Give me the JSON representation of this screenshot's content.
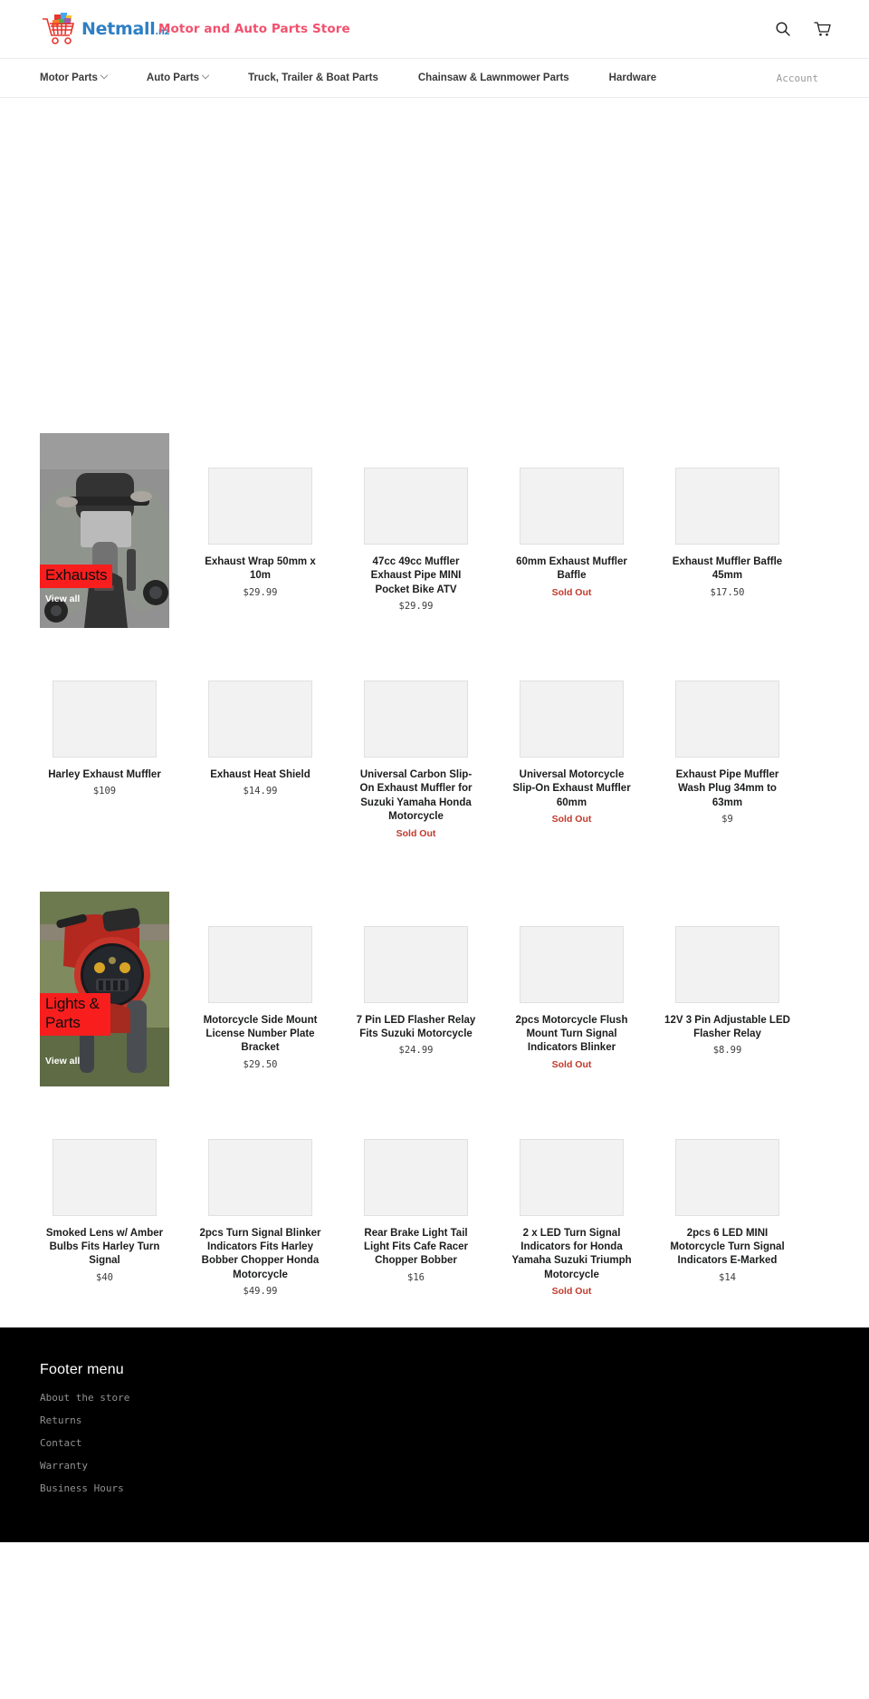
{
  "header": {
    "brand_name": "Netmall",
    "brand_tld": ".nz",
    "tagline": "Motor and Auto Parts Store",
    "brand_color": "#2f7fc4",
    "tagline_color": "#f2506e",
    "search_icon": "search-icon",
    "cart_icon": "cart-icon"
  },
  "nav": {
    "items": [
      {
        "label": "Motor Parts",
        "has_dropdown": true
      },
      {
        "label": "Auto Parts",
        "has_dropdown": true
      },
      {
        "label": "Truck, Trailer & Boat Parts",
        "has_dropdown": false
      },
      {
        "label": "Chainsaw & Lawnmower Parts",
        "has_dropdown": false
      },
      {
        "label": "Hardware",
        "has_dropdown": false
      }
    ],
    "account_label": "Account"
  },
  "collections": [
    {
      "title": "Exhausts",
      "view_all": "View all",
      "label_color": "#f91e1e",
      "image": "motorcycle-rear-exhaust-photo"
    },
    {
      "title": "Lights & Parts",
      "view_all": "View all",
      "label_color": "#f91e1e",
      "image": "motorcycle-headlight-photo"
    }
  ],
  "sold_out_label": "Sold Out",
  "sold_out_color": "#c0392b",
  "product_rows": [
    {
      "has_promo": true,
      "promo_index": 0,
      "products": [
        {
          "title": "Exhaust Wrap 50mm x 10m",
          "price": "$29.99",
          "sold_out": false
        },
        {
          "title": "47cc 49cc Muffler Exhaust Pipe MINI Pocket Bike ATV",
          "price": "$29.99",
          "sold_out": false
        },
        {
          "title": "60mm Exhaust Muffler Baffle",
          "price": "",
          "sold_out": true
        },
        {
          "title": "Exhaust Muffler Baffle 45mm",
          "price": "$17.50",
          "sold_out": false
        }
      ]
    },
    {
      "has_promo": false,
      "products": [
        {
          "title": "Harley Exhaust Muffler",
          "price": "$109",
          "sold_out": false
        },
        {
          "title": "Exhaust Heat Shield",
          "price": "$14.99",
          "sold_out": false
        },
        {
          "title": "Universal Carbon Slip-On Exhaust Muffler for Suzuki Yamaha Honda Motorcycle",
          "price": "",
          "sold_out": true
        },
        {
          "title": "Universal Motorcycle Slip-On Exhaust Muffler 60mm",
          "price": "",
          "sold_out": true
        },
        {
          "title": "Exhaust Pipe Muffler Wash Plug 34mm to 63mm",
          "price": "$9",
          "sold_out": false
        }
      ]
    },
    {
      "has_promo": true,
      "promo_index": 1,
      "products": [
        {
          "title": "Motorcycle Side Mount License Number Plate Bracket",
          "price": "$29.50",
          "sold_out": false
        },
        {
          "title": "7 Pin LED Flasher Relay Fits Suzuki Motorcycle",
          "price": "$24.99",
          "sold_out": false
        },
        {
          "title": "2pcs Motorcycle Flush Mount Turn Signal Indicators Blinker",
          "price": "",
          "sold_out": true
        },
        {
          "title": "12V 3 Pin Adjustable LED Flasher Relay",
          "price": "$8.99",
          "sold_out": false
        }
      ]
    },
    {
      "has_promo": false,
      "products": [
        {
          "title": "Smoked Lens w/ Amber Bulbs Fits Harley Turn Signal",
          "price": "$40",
          "sold_out": false
        },
        {
          "title": "2pcs Turn Signal Blinker Indicators Fits Harley Bobber Chopper Honda Motorcycle",
          "price": "$49.99",
          "sold_out": false
        },
        {
          "title": "Rear Brake Light Tail Light Fits Cafe Racer Chopper Bobber",
          "price": "$16",
          "sold_out": false
        },
        {
          "title": "2 x LED Turn Signal Indicators for Honda Yamaha Suzuki Triumph Motorcycle",
          "price": "",
          "sold_out": true
        },
        {
          "title": "2pcs 6 LED MINI Motorcycle Turn Signal Indicators E-Marked",
          "price": "$14",
          "sold_out": false
        }
      ]
    }
  ],
  "footer": {
    "title": "Footer menu",
    "links": [
      "About the store",
      "Returns",
      "Contact",
      "Warranty",
      "Business Hours"
    ]
  }
}
